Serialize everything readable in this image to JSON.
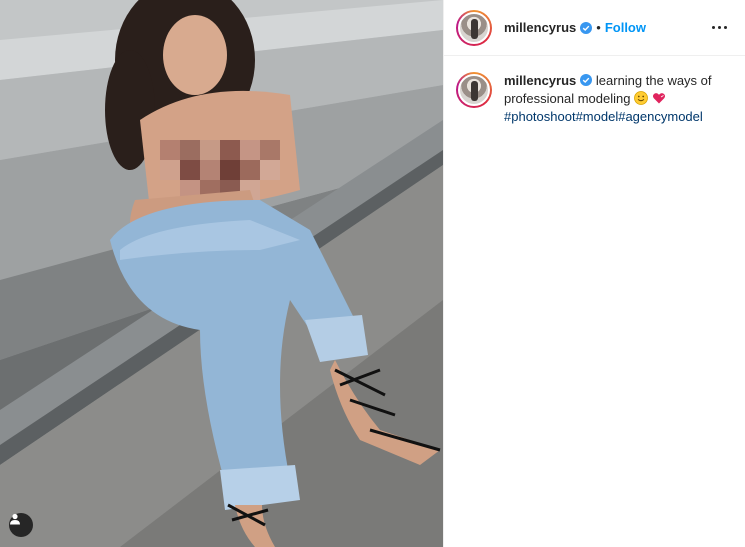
{
  "post": {
    "username": "millencyrus",
    "verified_icon": "verified-badge-icon",
    "separator": "•",
    "follow_label": "Follow",
    "more_icon": "more-options-icon",
    "caption": {
      "username": "millencyrus",
      "text_line1": "learning the ways of",
      "text_line2": "professional modeling",
      "emojis": [
        "smiling-face-emoji",
        "heart-emoji"
      ],
      "hashtags": [
        "#photoshoot",
        "#model",
        "#agencymodel"
      ]
    },
    "media": {
      "description_icon": "photo",
      "user_tag_icon": "user-tag-icon"
    },
    "colors": {
      "link_blue": "#0095f6",
      "hashtag_blue": "#00376b",
      "text": "#262626",
      "border": "#efefef"
    }
  }
}
